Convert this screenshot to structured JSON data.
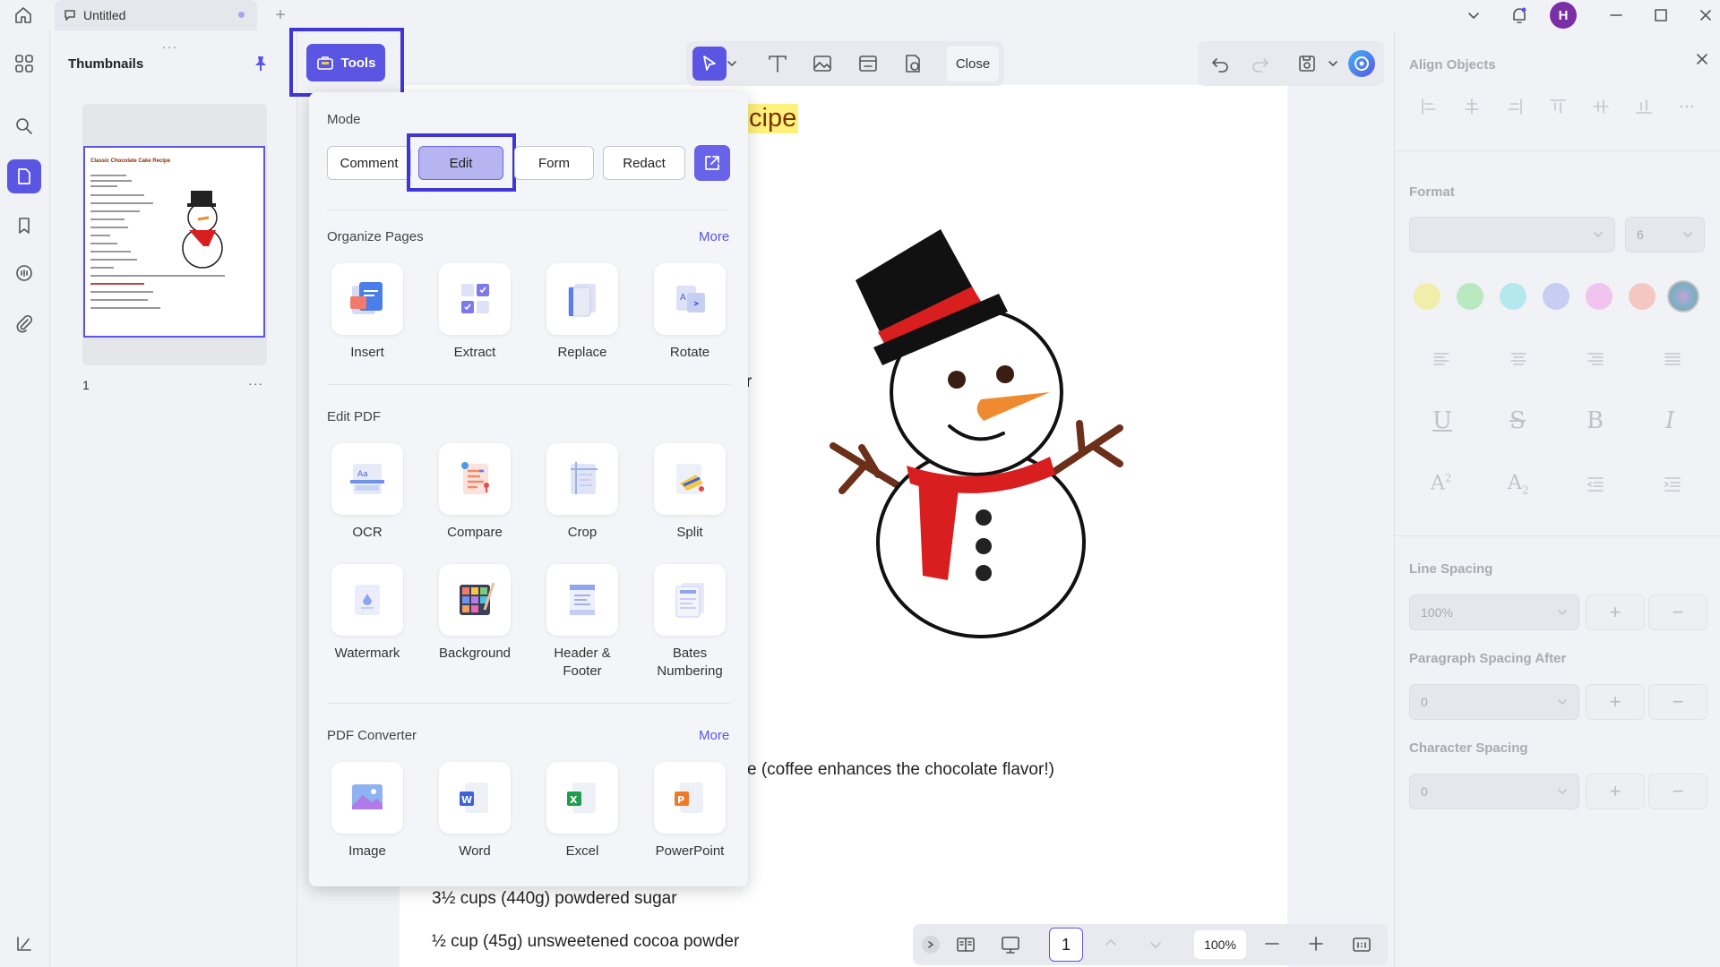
{
  "tab": {
    "title": "Untitled"
  },
  "user": {
    "initial": "H"
  },
  "sidebar": {
    "title": "Thumbnails",
    "page_number": "1",
    "more": "···",
    "handle": "···"
  },
  "toolbar": {
    "tools_label": "Tools",
    "close_label": "Close"
  },
  "document": {
    "title_fragment": "cipe",
    "line_fragment_r": "r",
    "coffee_line": "e (coffee enhances the chocolate flavor!)",
    "sugar_line": "3½ cups (440g) powdered sugar",
    "cocoa_line": "½ cup (45g) unsweetened cocoa powder",
    "thumbnail_title": "Classic Chocolate Cake Recipe"
  },
  "tools_panel": {
    "mode_title": "Mode",
    "modes": [
      "Comment",
      "Edit",
      "Form",
      "Redact"
    ],
    "active_mode": "Edit",
    "organize_title": "Organize Pages",
    "organize_more": "More",
    "organize_items": [
      "Insert",
      "Extract",
      "Replace",
      "Rotate"
    ],
    "edit_title": "Edit PDF",
    "edit_items": [
      "OCR",
      "Compare",
      "Crop",
      "Split",
      "Watermark",
      "Background",
      "Header &\nFooter",
      "Bates\nNumbering"
    ],
    "converter_title": "PDF Converter",
    "converter_more": "More",
    "converter_items": [
      "Image",
      "Word",
      "Excel",
      "PowerPoint"
    ]
  },
  "right_panel": {
    "align_title": "Align Objects",
    "format_title": "Format",
    "font_size": "6",
    "line_spacing_title": "Line Spacing",
    "line_spacing_value": "100%",
    "para_spacing_title": "Paragraph Spacing After",
    "para_spacing_value": "0",
    "char_spacing_title": "Character Spacing",
    "char_spacing_value": "0",
    "swatch_colors": [
      "#f1edaa",
      "#b9e8c1",
      "#b3e8ee",
      "#c8cdf2",
      "#f2c3ee",
      "#f4c7c2",
      "#9a9a9a"
    ]
  },
  "bottom_bar": {
    "page": "1",
    "zoom": "100%"
  },
  "colors": {
    "accent": "#5b55e3",
    "highlight_frame": "#4035d6"
  }
}
